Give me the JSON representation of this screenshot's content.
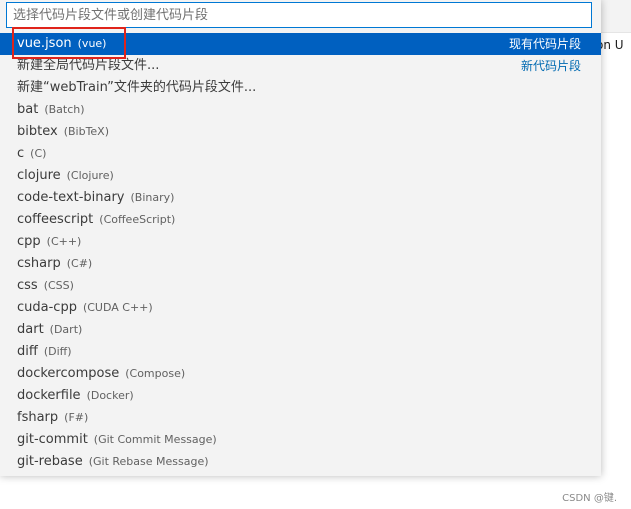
{
  "editor": {
    "fragment": "on U"
  },
  "quickpick": {
    "placeholder": "选择代码片段文件或创建代码片段",
    "items": [
      {
        "label": "vue.json",
        "description": "(vue)",
        "right": "现有代码片段",
        "selected": true
      },
      {
        "label": "新建全局代码片段文件...",
        "description": "",
        "right": "新代码片段"
      },
      {
        "label": "新建“webTrain”文件夹的代码片段文件...",
        "description": "",
        "right": ""
      },
      {
        "label": "bat",
        "description": "(Batch)",
        "right": ""
      },
      {
        "label": "bibtex",
        "description": "(BibTeX)",
        "right": ""
      },
      {
        "label": "c",
        "description": "(C)",
        "right": ""
      },
      {
        "label": "clojure",
        "description": "(Clojure)",
        "right": ""
      },
      {
        "label": "code-text-binary",
        "description": "(Binary)",
        "right": ""
      },
      {
        "label": "coffeescript",
        "description": "(CoffeeScript)",
        "right": ""
      },
      {
        "label": "cpp",
        "description": "(C++)",
        "right": ""
      },
      {
        "label": "csharp",
        "description": "(C#)",
        "right": ""
      },
      {
        "label": "css",
        "description": "(CSS)",
        "right": ""
      },
      {
        "label": "cuda-cpp",
        "description": "(CUDA C++)",
        "right": ""
      },
      {
        "label": "dart",
        "description": "(Dart)",
        "right": ""
      },
      {
        "label": "diff",
        "description": "(Diff)",
        "right": ""
      },
      {
        "label": "dockercompose",
        "description": "(Compose)",
        "right": ""
      },
      {
        "label": "dockerfile",
        "description": "(Docker)",
        "right": ""
      },
      {
        "label": "fsharp",
        "description": "(F#)",
        "right": ""
      },
      {
        "label": "git-commit",
        "description": "(Git Commit Message)",
        "right": ""
      },
      {
        "label": "git-rebase",
        "description": "(Git Rebase Message)",
        "right": ""
      }
    ]
  },
  "watermark": "CSDN @键."
}
